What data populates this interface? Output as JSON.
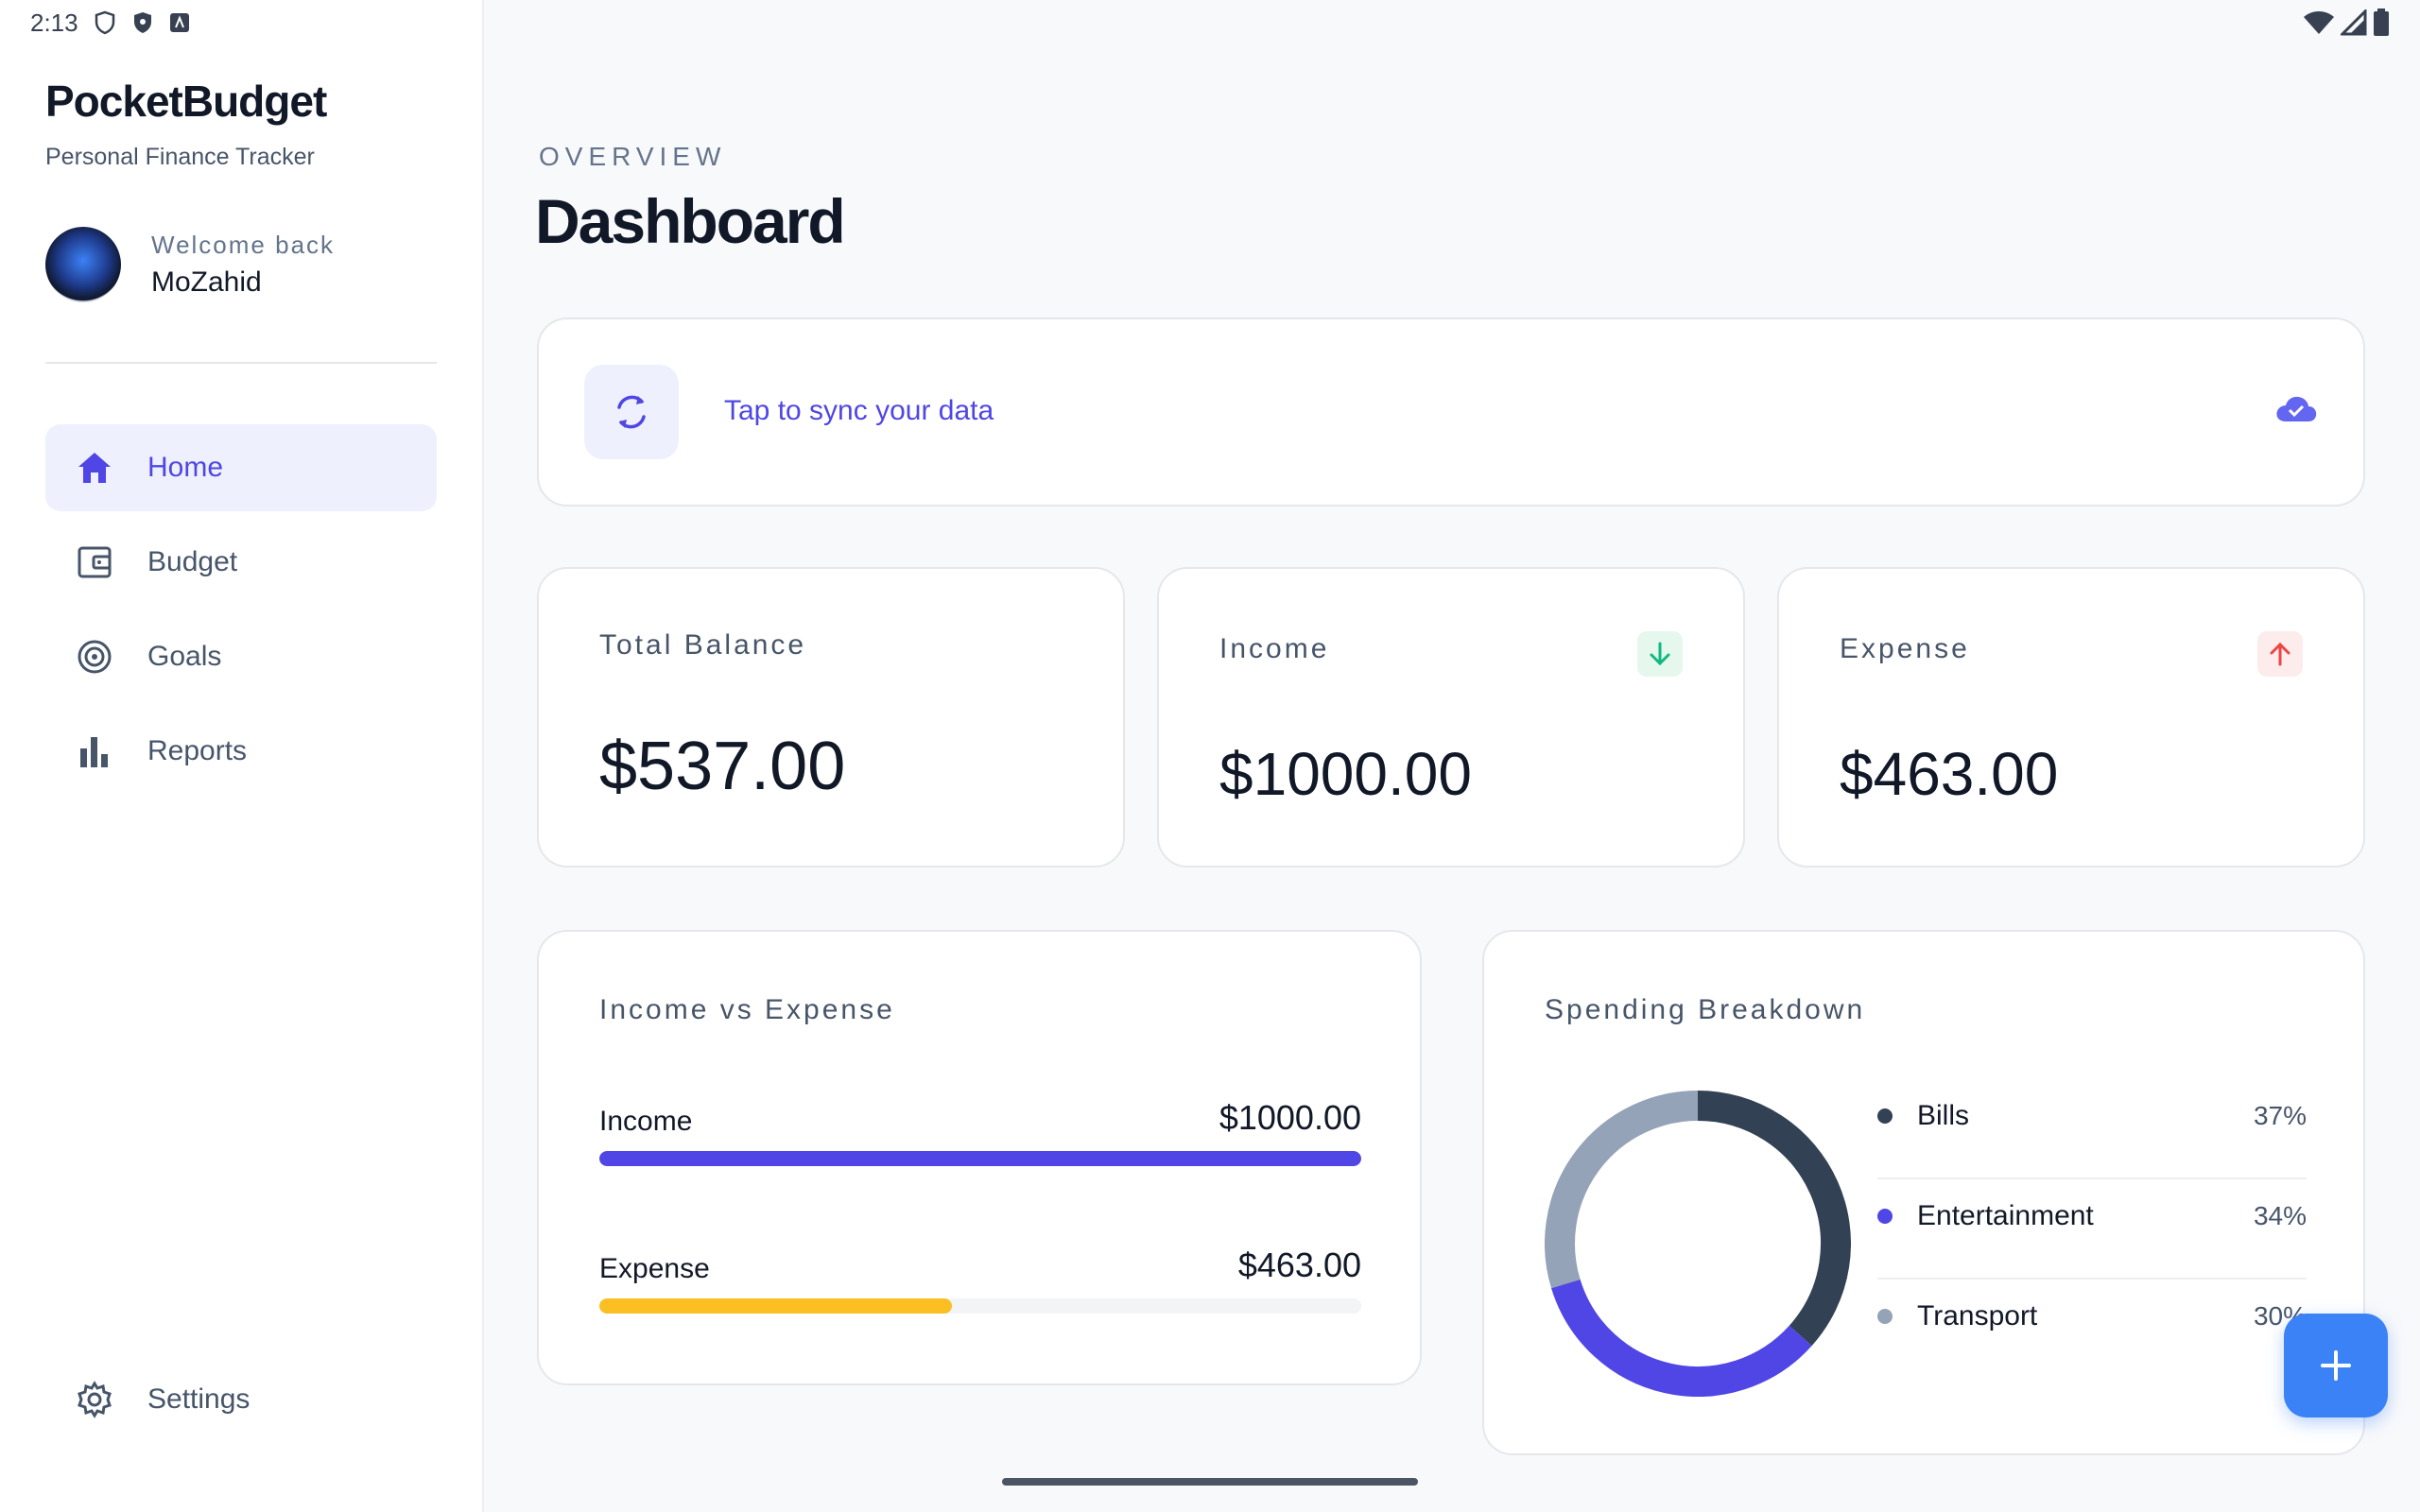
{
  "status_bar": {
    "time": "2:13"
  },
  "brand": {
    "title": "PocketBudget",
    "subtitle": "Personal Finance Tracker"
  },
  "user": {
    "welcome": "Welcome back",
    "name": "MoZahid"
  },
  "nav": {
    "items": [
      {
        "label": "Home",
        "icon": "home-icon",
        "active": true
      },
      {
        "label": "Budget",
        "icon": "wallet-icon",
        "active": false
      },
      {
        "label": "Goals",
        "icon": "target-icon",
        "active": false
      },
      {
        "label": "Reports",
        "icon": "bar-chart-icon",
        "active": false
      }
    ],
    "settings": {
      "label": "Settings",
      "icon": "gear-icon"
    }
  },
  "header": {
    "eyebrow": "OVERVIEW",
    "title": "Dashboard"
  },
  "sync": {
    "text": "Tap to sync your data",
    "icon": "sync-icon",
    "status_icon": "cloud-check-icon"
  },
  "stats": {
    "balance": {
      "label": "Total Balance",
      "value": "$537.00"
    },
    "income": {
      "label": "Income",
      "value": "$1000.00",
      "icon": "arrow-down-icon"
    },
    "expense": {
      "label": "Expense",
      "value": "$463.00",
      "icon": "arrow-up-icon"
    }
  },
  "income_vs_expense": {
    "title": "Income vs Expense",
    "rows": [
      {
        "label": "Income",
        "amount": "$1000.00",
        "fraction": 1.0,
        "color": "#4f46e5"
      },
      {
        "label": "Expense",
        "amount": "$463.00",
        "fraction": 0.463,
        "color": "#fbbf24"
      }
    ]
  },
  "spending": {
    "title": "Spending Breakdown",
    "items": [
      {
        "label": "Bills",
        "pct": "37%",
        "value": 37,
        "color": "#334155"
      },
      {
        "label": "Entertainment",
        "pct": "34%",
        "value": 34,
        "color": "#4f46e5"
      },
      {
        "label": "Transport",
        "pct": "30%",
        "value": 30,
        "color": "#94a3b8"
      }
    ]
  },
  "colors": {
    "accent": "#4f46e5",
    "fab": "#3b82f6",
    "income_badge": "#e6f7ee",
    "expense_badge": "#fdecec"
  },
  "fab": {
    "icon": "plus-icon"
  }
}
